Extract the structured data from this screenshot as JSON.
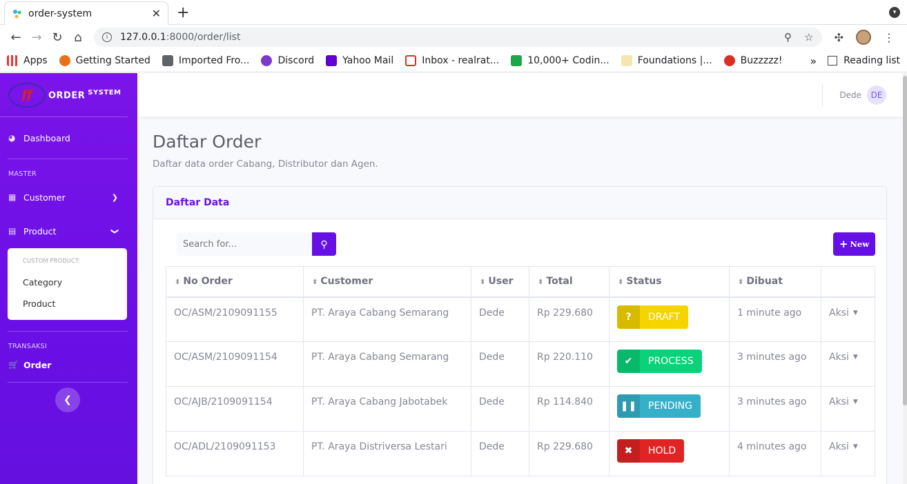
{
  "browser": {
    "tab_title": "order-system",
    "url_host": "127.0.0.1",
    "url_path": ":8000/order/list",
    "bookmarks": [
      {
        "label": "Apps",
        "color": "#e33"
      },
      {
        "label": "Getting Started",
        "color": "#e8711a"
      },
      {
        "label": "Imported Fro...",
        "color": "#5f6368"
      },
      {
        "label": "Discord",
        "color": "#7a3cc7"
      },
      {
        "label": "Yahoo Mail",
        "color": "#6001d2"
      },
      {
        "label": "Inbox - realrat...",
        "color": "#d93025"
      },
      {
        "label": "10,000+ Codin...",
        "color": "#1ea64a"
      },
      {
        "label": "Foundations |...",
        "color": "#e2b93b"
      },
      {
        "label": "Buzzzzz!",
        "color": "#d93025"
      }
    ],
    "bookmarks_more": "»",
    "reading_list": "Reading list"
  },
  "sidebar": {
    "brand_logo_text": "ff",
    "brand_name": "ORDER",
    "brand_sup": "SYSTEM",
    "dashboard": "Dashboard",
    "master_heading": "MASTER",
    "customer": "Customer",
    "product": "Product",
    "submenu_heading": "CUSTOM PRODUCT:",
    "submenu_items": [
      "Category",
      "Product"
    ],
    "transaksi_heading": "TRANSAKSI",
    "order": "Order"
  },
  "topbar": {
    "user_name": "Dede",
    "user_initials": "DE"
  },
  "page": {
    "title": "Daftar Order",
    "subtitle": "Daftar data order Cabang, Distributor dan Agen."
  },
  "card": {
    "title": "Daftar Data",
    "search_placeholder": "Search for...",
    "new_label": "New"
  },
  "table": {
    "headers": [
      "No Order",
      "Customer",
      "User",
      "Total",
      "Status",
      "Dibuat",
      ""
    ],
    "rows": [
      {
        "no": "OC/ASM/2109091155",
        "customer": "PT. Araya Cabang Semarang",
        "user": "Dede",
        "total": "Rp 229.680",
        "status": "DRAFT",
        "status_icon": "?",
        "status_color": "#f6d400",
        "dibuat": "1 minute ago",
        "aksi": "Aksi"
      },
      {
        "no": "OC/ASM/2109091154",
        "customer": "PT. Araya Cabang Semarang",
        "user": "Dede",
        "total": "Rp 220.110",
        "status": "PROCESS",
        "status_icon": "✔",
        "status_color": "#0ad27a",
        "dibuat": "3 minutes ago",
        "aksi": "Aksi"
      },
      {
        "no": "OC/AJB/2109091154",
        "customer": "PT. Araya Cabang Jabotabek",
        "user": "Dede",
        "total": "Rp 114.840",
        "status": "PENDING",
        "status_icon": "❚❚",
        "status_color": "#36b0c9",
        "dibuat": "3 minutes ago",
        "aksi": "Aksi"
      },
      {
        "no": "OC/ADL/2109091153",
        "customer": "PT. Araya Distriversa Lestari",
        "user": "Dede",
        "total": "Rp 229.680",
        "status": "HOLD",
        "status_icon": "✖",
        "status_color": "#e02424",
        "dibuat": "4 minutes ago",
        "aksi": "Aksi"
      }
    ]
  }
}
